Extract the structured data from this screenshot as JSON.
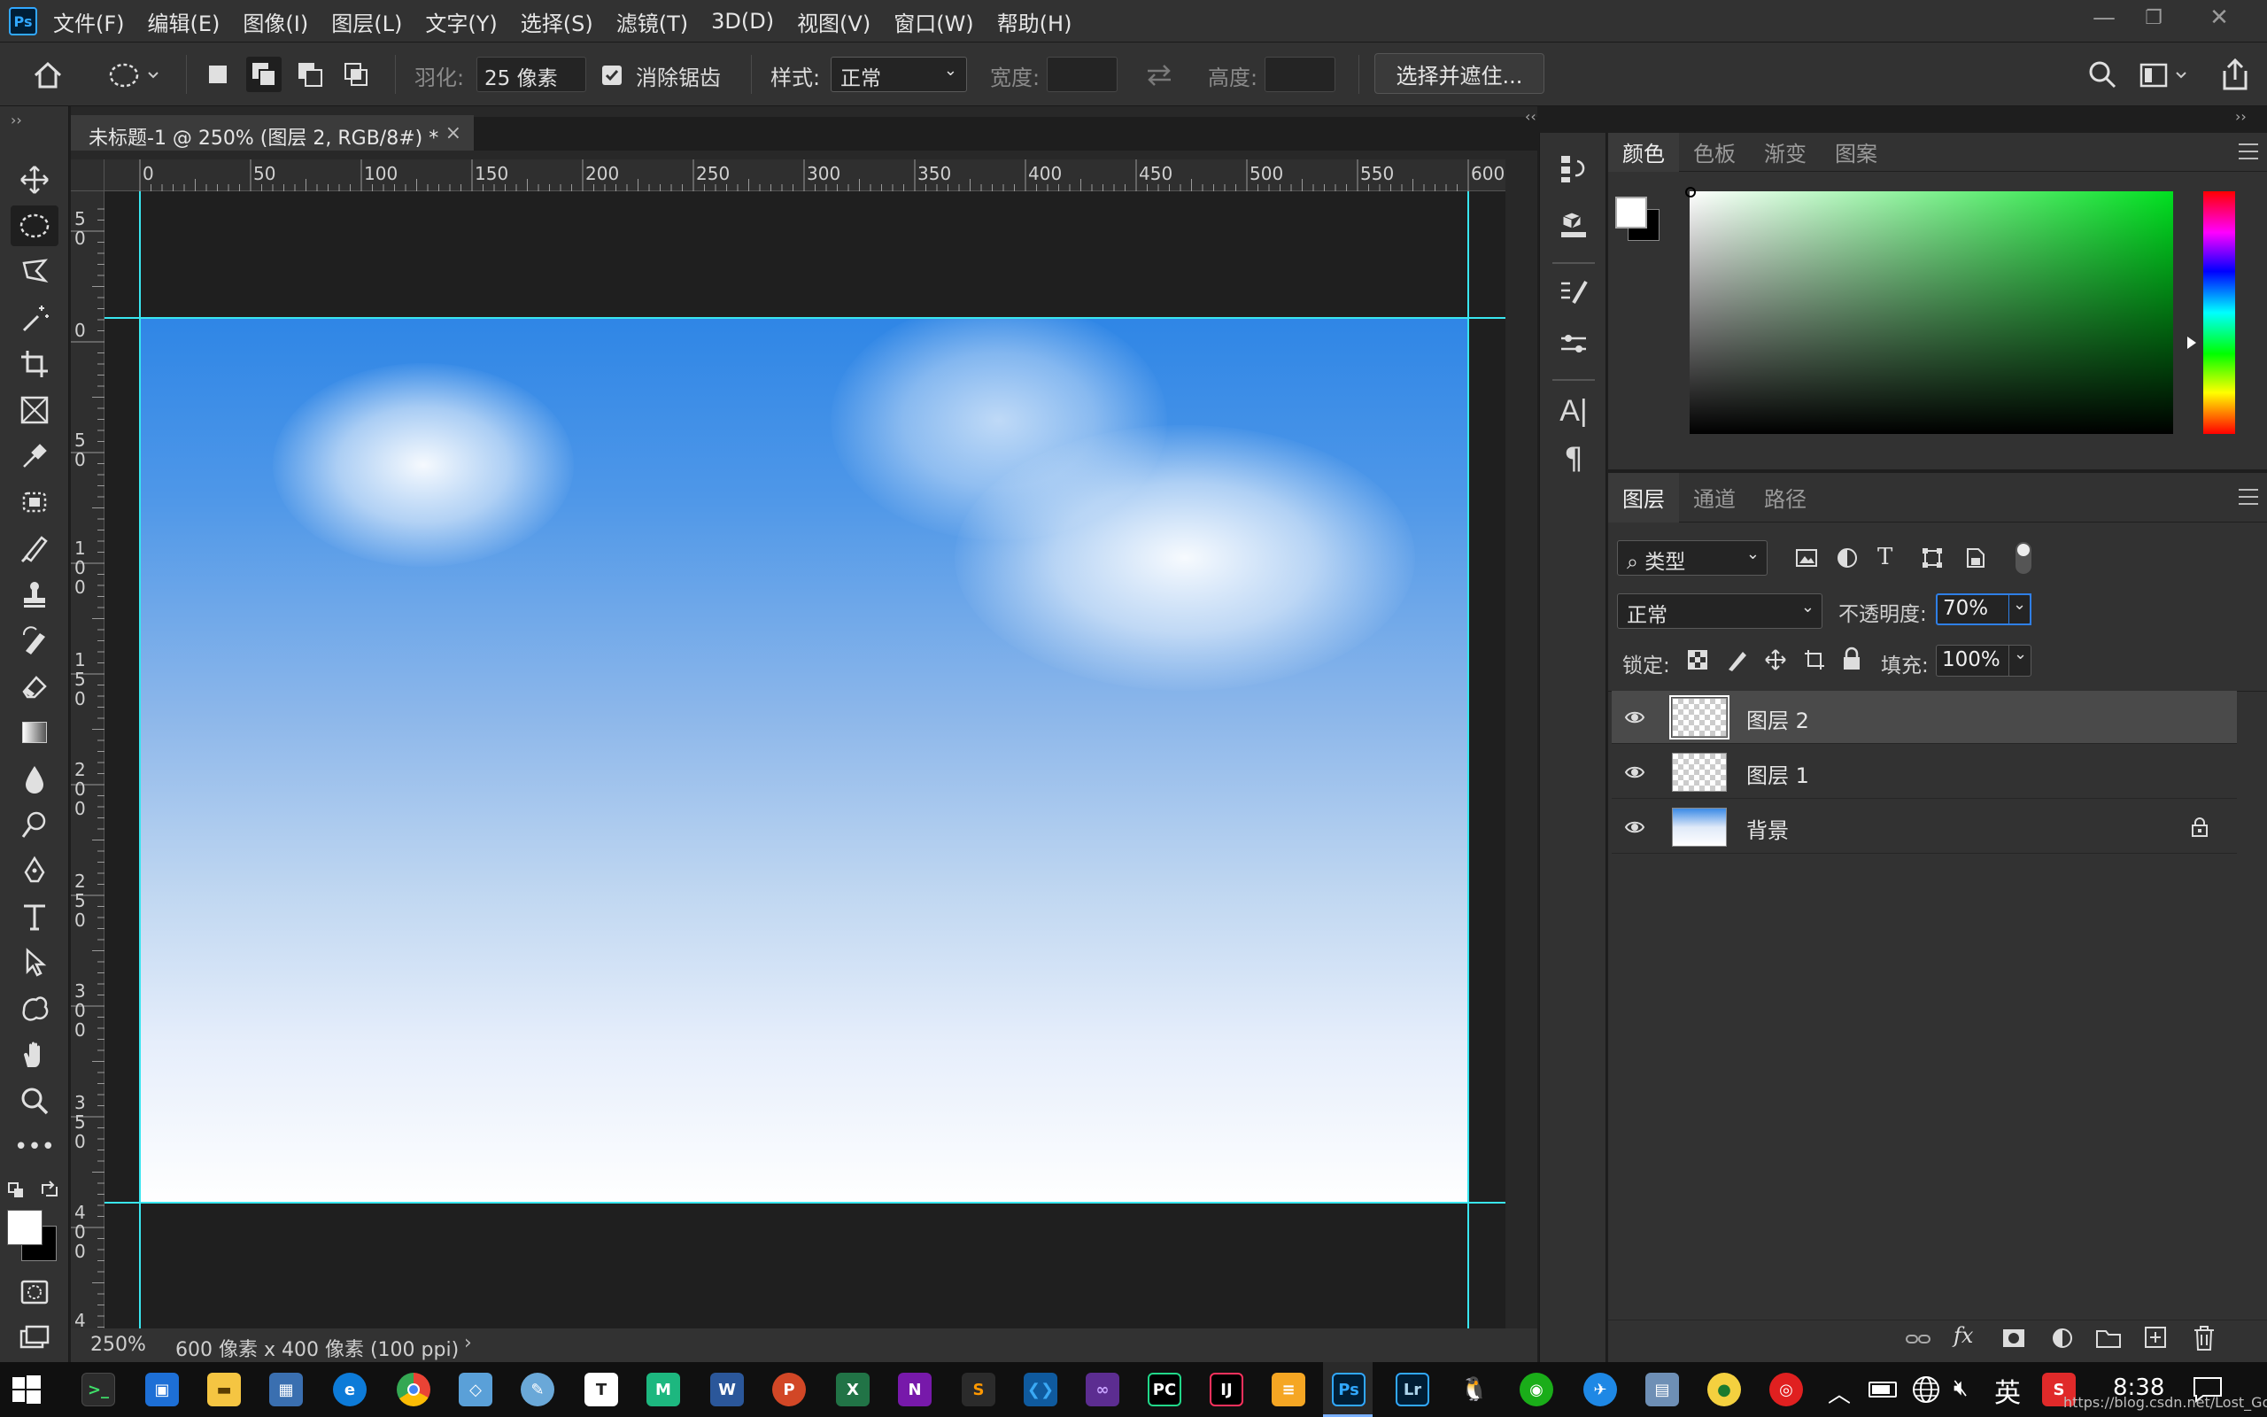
{
  "app": {
    "logo": "Ps"
  },
  "menu": [
    "文件(F)",
    "编辑(E)",
    "图像(I)",
    "图层(L)",
    "文字(Y)",
    "选择(S)",
    "滤镜(T)",
    "3D(D)",
    "视图(V)",
    "窗口(W)",
    "帮助(H)"
  ],
  "options": {
    "feather_label": "羽化:",
    "feather_value": "25 像素",
    "antialias_label": "消除锯齿",
    "style_label": "样式:",
    "style_value": "正常",
    "width_label": "宽度:",
    "height_label": "高度:",
    "select_mask_button": "选择并遮住..."
  },
  "document": {
    "tab_title": "未标题-1 @ 250% (图层 2, RGB/8#) *",
    "zoom": "250%",
    "size_info": "600 像素 x 400 像素 (100 ppi)"
  },
  "ruler": {
    "h_labels": [
      "0",
      "50",
      "100",
      "150",
      "200",
      "250",
      "300",
      "350",
      "400",
      "450",
      "500",
      "550",
      "600"
    ],
    "v_labels": [
      "5\n0",
      "0",
      "5\n0",
      "1\n0\n0",
      "1\n5\n0",
      "2\n0\n0",
      "2\n5\n0",
      "3\n0\n0",
      "3\n5\n0",
      "4\n0\n0",
      "4"
    ]
  },
  "color_panel": {
    "tabs": [
      "颜色",
      "色板",
      "渐变",
      "图案"
    ],
    "active_tab": 0
  },
  "layers_panel": {
    "tabs": [
      "图层",
      "通道",
      "路径"
    ],
    "active_tab": 0,
    "filter_label": "类型",
    "blend_mode": "正常",
    "opacity_label": "不透明度:",
    "opacity_value": "70%",
    "lock_label": "锁定:",
    "fill_label": "填充:",
    "fill_value": "100%",
    "layers": [
      {
        "name": "图层 2",
        "selected": true,
        "locked": false
      },
      {
        "name": "图层 1",
        "selected": false,
        "locked": false
      },
      {
        "name": "背景",
        "selected": false,
        "locked": true
      }
    ]
  },
  "taskbar": {
    "ime": "英",
    "clock": "8:38",
    "watermark": "https://blog.csdn.net/Lost_God"
  },
  "colors": {
    "accent": "#31a8ff",
    "guide": "#39e6f0",
    "sky_top": "#2f86e6"
  }
}
